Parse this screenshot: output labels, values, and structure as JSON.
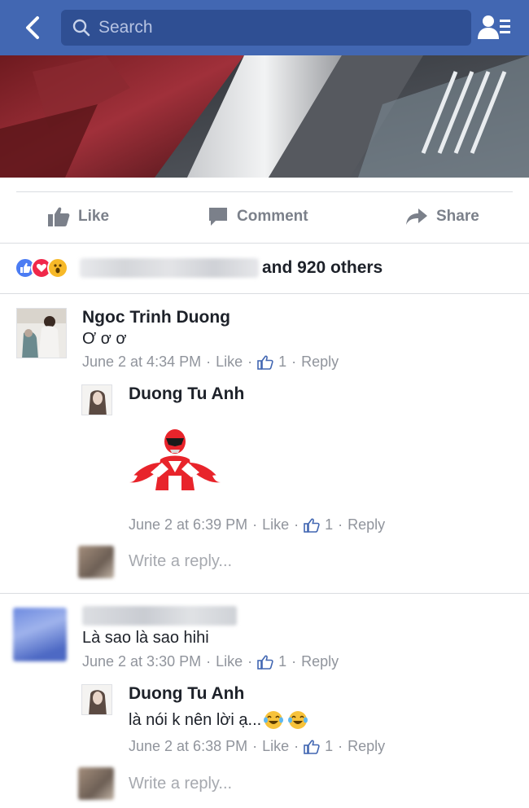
{
  "navbar": {
    "search_placeholder": "Search",
    "bg_color": "#4267b2",
    "icons": {
      "back": "chevron-left-icon",
      "search": "search-icon",
      "friends": "friend-requests-icon"
    }
  },
  "actions": {
    "like": "Like",
    "comment": "Comment",
    "share": "Share"
  },
  "reactions": {
    "types": [
      "like",
      "love",
      "wow"
    ],
    "colors": {
      "like": "#4b7cf3",
      "love": "#f0284a",
      "wow": "#f7b928"
    },
    "others_text": "and 920 others"
  },
  "comments": [
    {
      "name": "Ngoc Trinh Duong",
      "text": "Ơ ơ ơ",
      "time": "June 2 at 4:34 PM",
      "like_label": "Like",
      "like_count": "1",
      "reply_label": "Reply",
      "replies": [
        {
          "name": "Duong Tu Anh",
          "sticker": "red-ranger-heart-hands-sticker",
          "time": "June 2 at 6:39 PM",
          "like_label": "Like",
          "like_count": "1",
          "reply_label": "Reply"
        }
      ],
      "write_reply_placeholder": "Write a reply..."
    },
    {
      "name": "",
      "text": "Là sao là sao hihi",
      "time": "June 2 at 3:30 PM",
      "like_label": "Like",
      "like_count": "1",
      "reply_label": "Reply",
      "replies": [
        {
          "name": "Duong Tu Anh",
          "text": "là nói k nên lời ạ...",
          "emoji": [
            "tears-of-joy-emoji",
            "tears-of-joy-emoji"
          ],
          "time": "June 2 at 6:38 PM",
          "like_label": "Like",
          "like_count": "1",
          "reply_label": "Reply"
        }
      ],
      "write_reply_placeholder": "Write a reply..."
    }
  ],
  "colors": {
    "meta_text": "#90949c",
    "like_thumb": "#4267b2"
  }
}
